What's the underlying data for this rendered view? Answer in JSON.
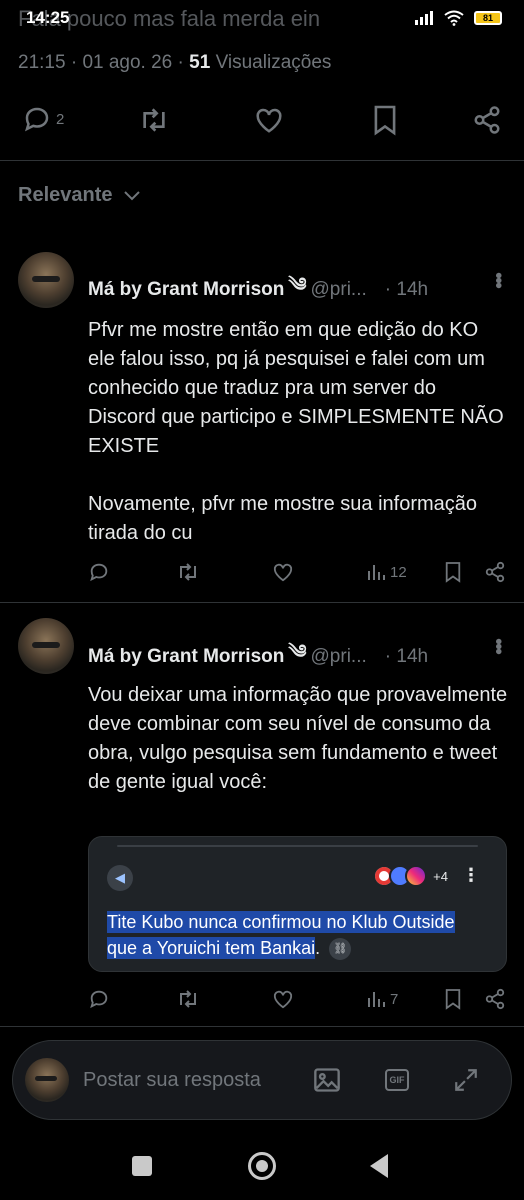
{
  "status_bar": {
    "ghost_text": "Fala pouco mas fala merda ein",
    "time": "14:25",
    "battery": "81"
  },
  "tweet_meta": {
    "time": "21:15",
    "sep1": "·",
    "date": "01 ago. 26",
    "sep2": "·",
    "views_count": "51",
    "views_label": "Visualizações"
  },
  "main_actions": {
    "reply_count": "2"
  },
  "sort": {
    "label": "Relevante"
  },
  "replies": [
    {
      "author_name": "Má by Grant Morrison",
      "verified_glyph": "༄",
      "handle": "@pri...",
      "ago": "· 14h",
      "text": "Pfvr me mostre então em que edição do KO ele falou isso, pq já pesquisei e falei com um conhecido que traduz pra um server do Discord que participo e SIMPLESMENTE NÃO EXISTE\n\nNovamente, pfvr me mostre sua informação tirada do cu",
      "views": "12"
    },
    {
      "author_name": "Má by Grant Morrison",
      "verified_glyph": "༄",
      "handle": "@pri...",
      "ago": "· 14h",
      "text": "Vou deixar uma informação que provavelmente deve combinar com seu nível de consumo da obra, vulgo pesquisa sem fundamento e tweet de gente igual você:",
      "views": "7",
      "embed": {
        "sources_more": "+4",
        "claim_part1": "Tite Kubo nunca confirmou no Klub Outside",
        "claim_part2": " que a Yoruichi tem Bankai",
        "claim_end": "."
      }
    }
  ],
  "reply_bar": {
    "placeholder": "Postar sua resposta",
    "gif_label": "GIF"
  },
  "icons": [
    "reply-icon",
    "retweet-icon",
    "like-icon",
    "bookmark-icon",
    "share-icon",
    "views-icon",
    "image-icon",
    "gif-icon",
    "expand-icon",
    "chevron-down-icon",
    "more-icon"
  ],
  "colors": {
    "background": "#000000",
    "text": "#e7e9ea",
    "muted": "#71767b",
    "divider": "#2f3336",
    "highlight": "#1f4aa8"
  }
}
